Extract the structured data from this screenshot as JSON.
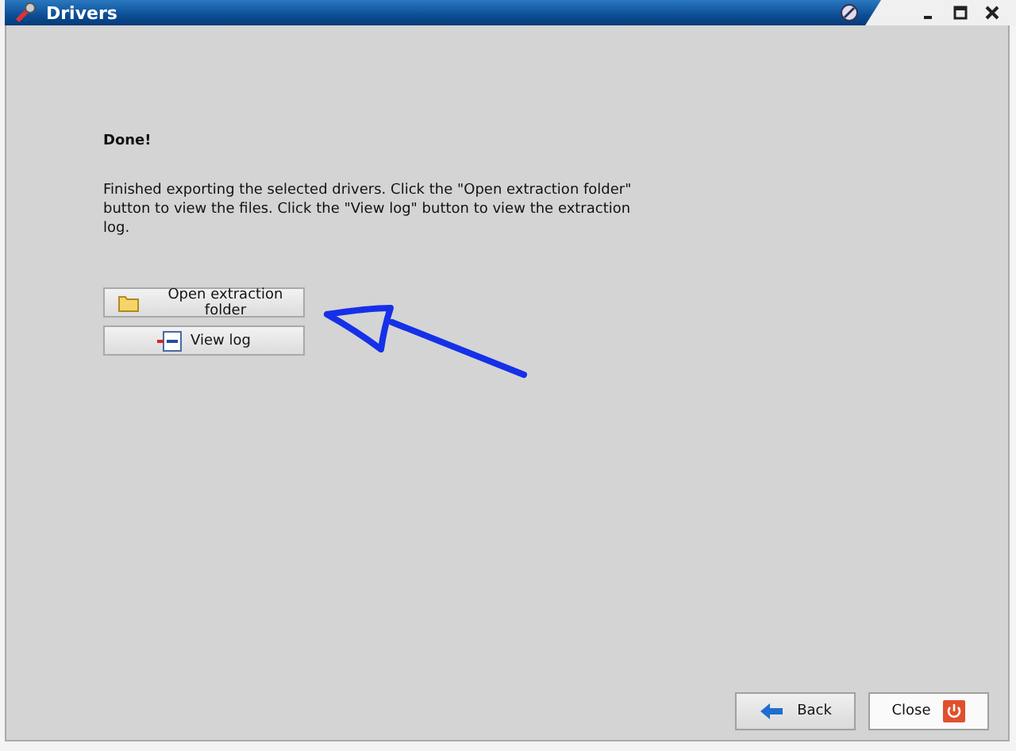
{
  "window": {
    "title": "Drivers"
  },
  "heading": "Done!",
  "message": "Finished exporting the selected drivers. Click the \"Open extraction folder\" button to view the files. Click the \"View log\" button to view the extraction log.",
  "actions": [
    {
      "kind": "folder",
      "label": "Open extraction folder"
    },
    {
      "kind": "log",
      "label": "View log"
    }
  ],
  "footer_buttons": [
    {
      "kind": "back",
      "label": "Back"
    },
    {
      "kind": "close",
      "label": "Close"
    }
  ]
}
